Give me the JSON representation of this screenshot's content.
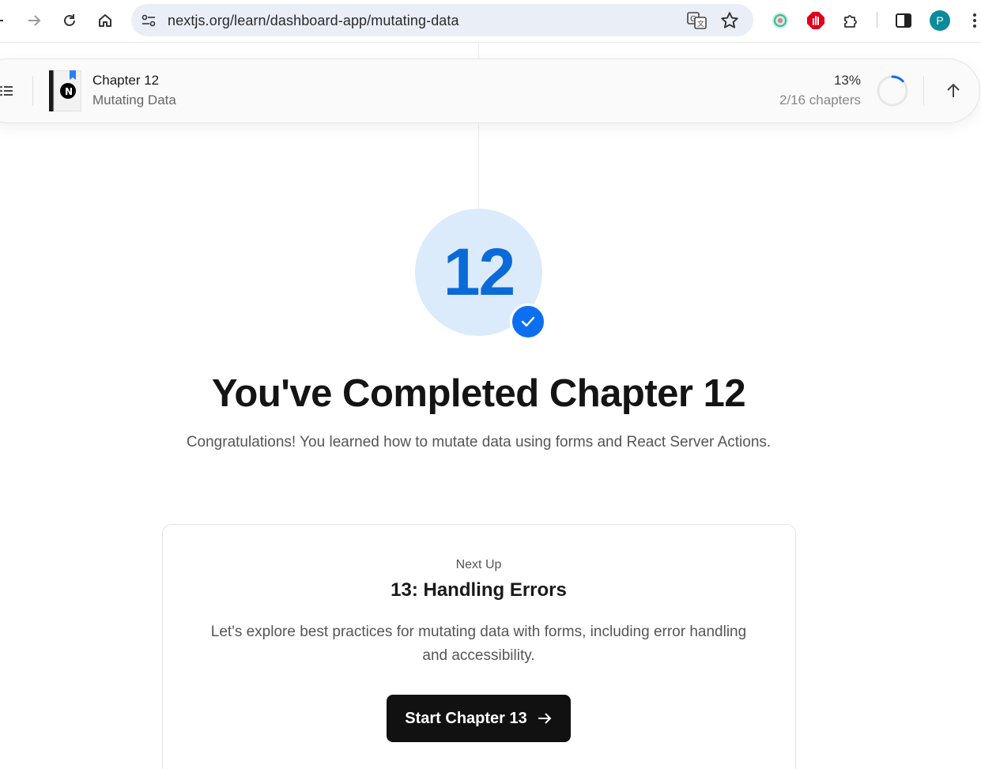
{
  "browser": {
    "url": "nextjs.org/learn/dashboard-app/mutating-data",
    "avatar_letter": "P",
    "icons": [
      "back-arrow-icon",
      "forward-arrow-icon",
      "reload-icon",
      "home-icon",
      "site-info-icon",
      "translate-icon",
      "star-icon",
      "extension-icon",
      "adblock-icon",
      "puzzle-icon",
      "side-panel-icon",
      "menu-icon"
    ]
  },
  "chapter_bar": {
    "title": "Chapter 12",
    "subtitle": "Mutating Data",
    "percent": "13%",
    "chapters": "2/16 chapters",
    "progress_fraction": 0.13
  },
  "completion": {
    "badge_number": "12",
    "headline": "You've Completed Chapter 12",
    "message": "Congratulations! You learned how to mutate data using forms and React Server Actions."
  },
  "next_up": {
    "label": "Next Up",
    "title": "13: Handling Errors",
    "description": "Let's explore best practices for mutating data with forms, including error handling and accessibility.",
    "button_label": "Start Chapter 13"
  },
  "colors": {
    "accent": "#0b6ff0",
    "badge_bg": "#dcebfb",
    "badge_number": "#0a6ad8",
    "button_bg": "#111111"
  }
}
